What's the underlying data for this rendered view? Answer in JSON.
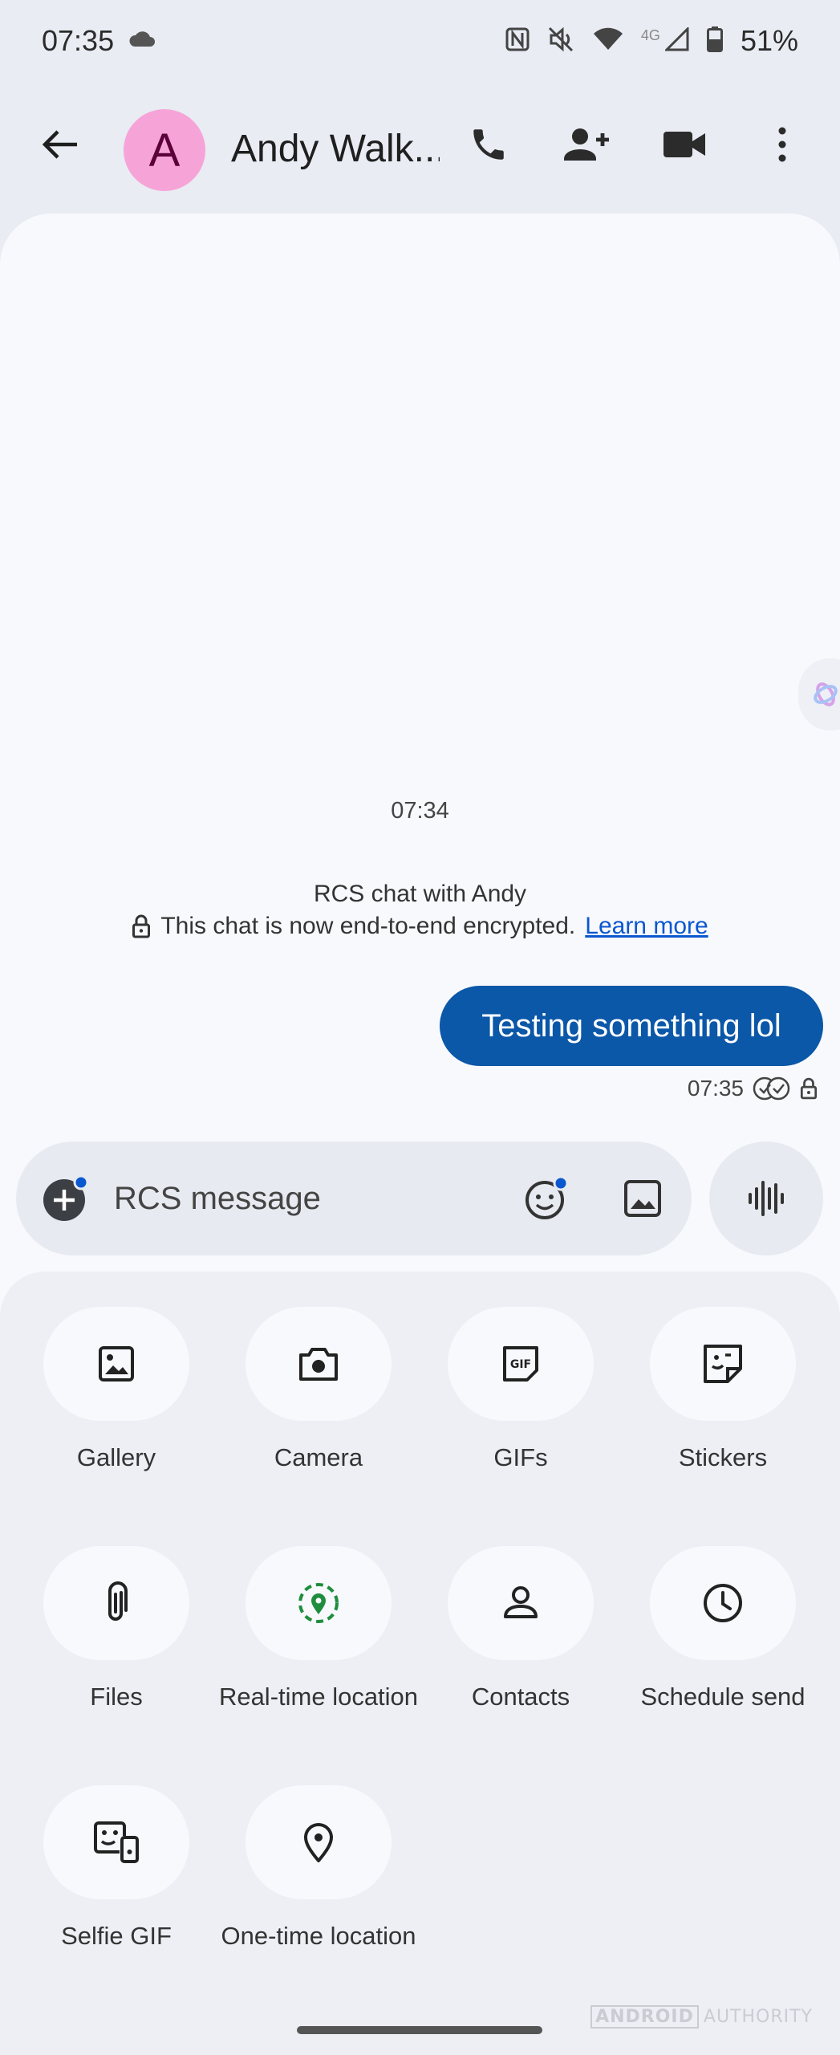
{
  "status_bar": {
    "time": "07:35",
    "network": "4G",
    "battery": "51%"
  },
  "header": {
    "avatar_letter": "A",
    "contact_name": "Andy Walk..."
  },
  "chat": {
    "timestamp": "07:34",
    "rcs_title": "RCS chat with Andy",
    "encryption_text": "This chat is now end-to-end encrypted.",
    "learn_more": "Learn more",
    "messages": [
      {
        "text": "Testing something lol",
        "time": "07:35",
        "direction": "outgoing"
      }
    ]
  },
  "composer": {
    "placeholder": "RCS message"
  },
  "attachments": [
    {
      "label": "Gallery",
      "icon": "gallery-icon"
    },
    {
      "label": "Camera",
      "icon": "camera-icon"
    },
    {
      "label": "GIFs",
      "icon": "gif-icon"
    },
    {
      "label": "Stickers",
      "icon": "sticker-icon"
    },
    {
      "label": "Files",
      "icon": "paperclip-icon"
    },
    {
      "label": "Real-time location",
      "icon": "live-location-icon"
    },
    {
      "label": "Contacts",
      "icon": "person-icon"
    },
    {
      "label": "Schedule send",
      "icon": "clock-icon"
    },
    {
      "label": "Selfie GIF",
      "icon": "selfie-gif-icon"
    },
    {
      "label": "One-time location",
      "icon": "location-pin-icon"
    }
  ],
  "watermark": {
    "brand": "ANDROID",
    "suffix": "AUTHORITY"
  },
  "colors": {
    "bubble": "#0b57a8",
    "avatar": "#f6a4d8",
    "link": "#0b57d0",
    "live_location": "#1e8e3e"
  }
}
